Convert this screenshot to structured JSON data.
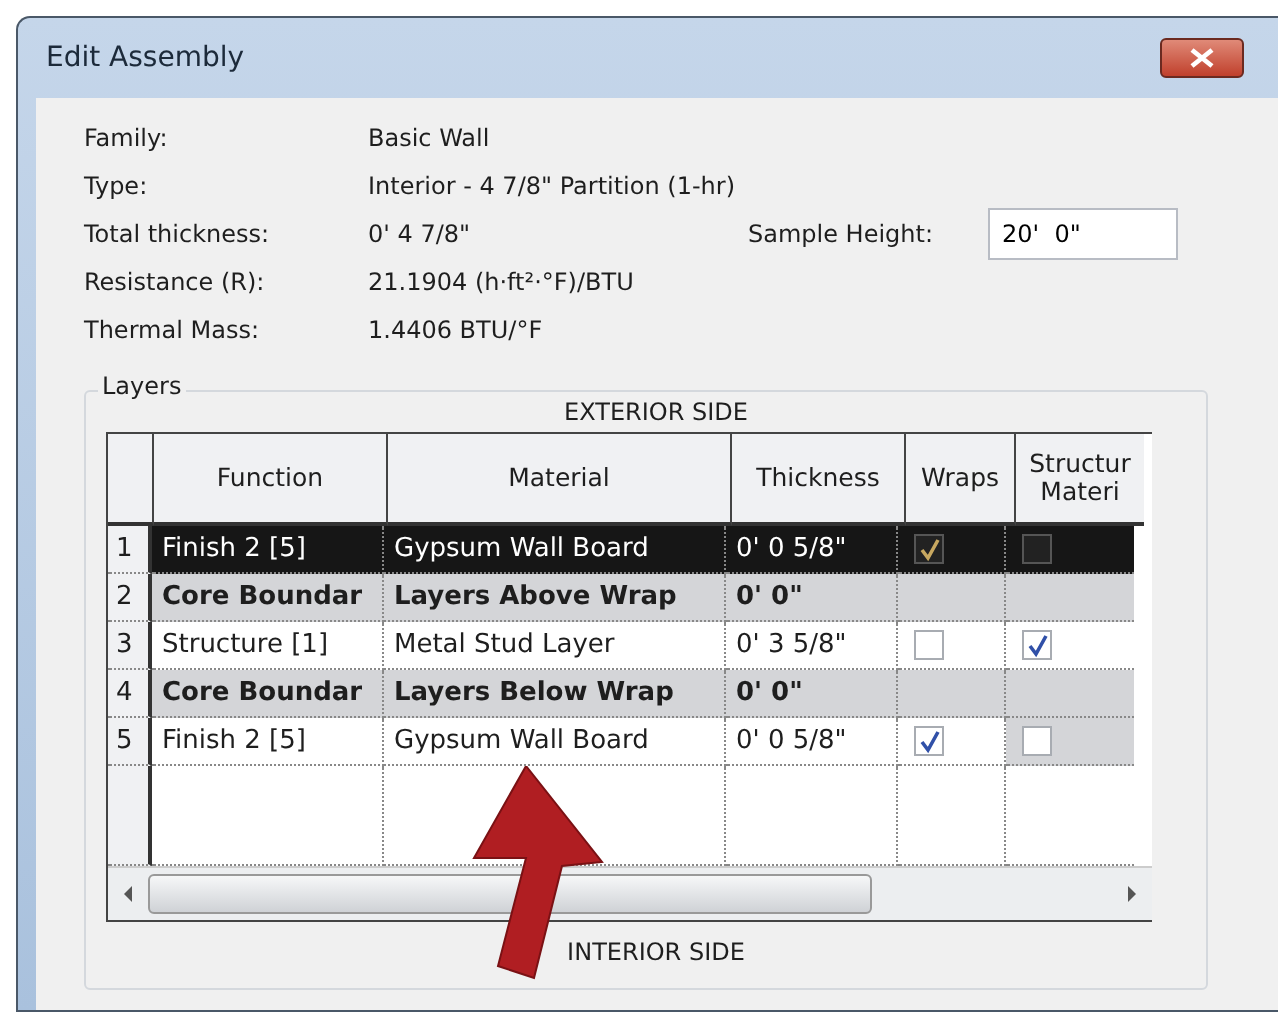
{
  "window": {
    "title": "Edit Assembly"
  },
  "properties": [
    {
      "label": "Family:",
      "value": "Basic Wall"
    },
    {
      "label": "Type:",
      "value": "Interior - 4 7/8\" Partition (1-hr)"
    },
    {
      "label": "Total thickness:",
      "value": "0'  4 7/8\""
    },
    {
      "label": "Resistance (R):",
      "value": "21.1904 (h·ft²·°F)/BTU"
    },
    {
      "label": "Thermal Mass:",
      "value": "1.4406 BTU/°F"
    }
  ],
  "sample_height": {
    "label": "Sample Height:",
    "value": "20'  0\""
  },
  "layers": {
    "title": "Layers",
    "top_label": "EXTERIOR SIDE",
    "bottom_label": "INTERIOR SIDE",
    "columns": [
      "Function",
      "Material",
      "Thickness",
      "Wraps",
      "Structur\nMateri"
    ],
    "rows": [
      {
        "number": "1",
        "kind": "layer",
        "selected": true,
        "function": "Finish 2 [5]",
        "material": "Gypsum Wall Board",
        "thickness": "0'  0 5/8\"",
        "wraps": true,
        "structural": false
      },
      {
        "number": "2",
        "kind": "boundary",
        "selected": false,
        "function": "Core Boundar",
        "material": "Layers Above Wrap",
        "thickness": "0'  0\""
      },
      {
        "number": "3",
        "kind": "layer",
        "selected": false,
        "function": "Structure [1]",
        "material": "Metal Stud Layer",
        "thickness": "0'  3 5/8\"",
        "wraps": false,
        "structural": true
      },
      {
        "number": "4",
        "kind": "boundary",
        "selected": false,
        "function": "Core Boundar",
        "material": "Layers Below Wrap",
        "thickness": "0'  0\""
      },
      {
        "number": "5",
        "kind": "layer",
        "selected": false,
        "function": "Finish 2 [5]",
        "material": "Gypsum Wall Board",
        "thickness": "0'  0 5/8\"",
        "wraps": true,
        "structural": false
      }
    ]
  }
}
